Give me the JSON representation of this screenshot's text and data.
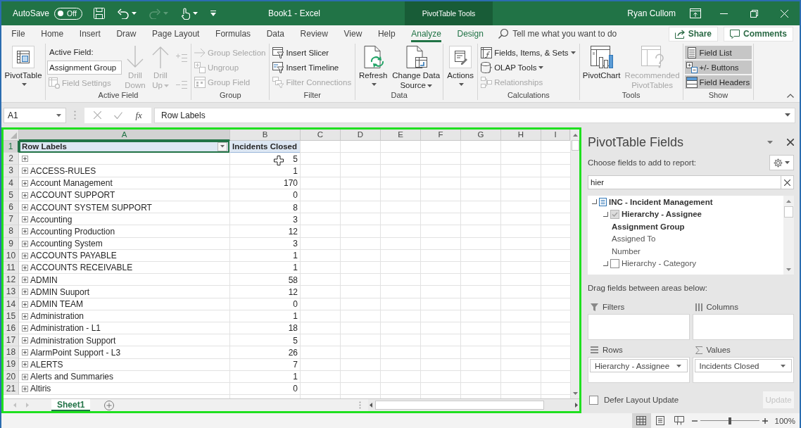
{
  "title_bar": {
    "autosave_label": "AutoSave",
    "autosave_toggle": {
      "label": "Off",
      "on": false
    },
    "document_title": "Book1 - Excel",
    "context_label": "PivotTable Tools",
    "user_name": "Ryan Cullom"
  },
  "ribbon_tabs": [
    {
      "label": "File",
      "kind": "standard",
      "selected": false
    },
    {
      "label": "Home",
      "kind": "standard",
      "selected": false
    },
    {
      "label": "Insert",
      "kind": "standard",
      "selected": false
    },
    {
      "label": "Draw",
      "kind": "standard",
      "selected": false
    },
    {
      "label": "Page Layout",
      "kind": "standard",
      "selected": false
    },
    {
      "label": "Formulas",
      "kind": "standard",
      "selected": false
    },
    {
      "label": "Data",
      "kind": "standard",
      "selected": false
    },
    {
      "label": "Review",
      "kind": "standard",
      "selected": false
    },
    {
      "label": "View",
      "kind": "standard",
      "selected": false
    },
    {
      "label": "Help",
      "kind": "standard",
      "selected": false
    },
    {
      "label": "Analyze",
      "kind": "contextual",
      "selected": true
    },
    {
      "label": "Design",
      "kind": "contextual",
      "selected": false
    }
  ],
  "tell_me": {
    "placeholder": "Tell me what you want to do"
  },
  "share_button": {
    "label": "Share"
  },
  "comments_button": {
    "label": "Comments"
  },
  "ribbon_groups": [
    {
      "controls": [
        {
          "kind": "large",
          "label": "PivotTable",
          "disabled": false,
          "dropdown": true
        }
      ]
    },
    {
      "label": "Active Field",
      "controls": [
        {
          "kind": "field",
          "label": "Active Field:",
          "value": "Assignment Group",
          "items": [
            {
              "label": "Field Settings",
              "disabled": true,
              "dropdown": false
            }
          ]
        },
        {
          "kind": "large",
          "label": "Drill Down",
          "disabled": true,
          "dropdown": false
        },
        {
          "kind": "large",
          "label": "Drill Up",
          "disabled": true,
          "dropdown": true
        },
        {
          "kind": "icons",
          "items": [
            {
              "disabled": true
            },
            {
              "disabled": true
            }
          ]
        }
      ]
    },
    {
      "label": "Group",
      "controls": [
        {
          "kind": "stack",
          "items": [
            {
              "label": "Group Selection",
              "disabled": true,
              "dropdown": false
            },
            {
              "label": "Ungroup",
              "disabled": true,
              "dropdown": false
            },
            {
              "label": "Group Field",
              "disabled": true,
              "dropdown": false
            }
          ]
        }
      ]
    },
    {
      "label": "Filter",
      "controls": [
        {
          "kind": "stack",
          "items": [
            {
              "label": "Insert Slicer",
              "disabled": false,
              "dropdown": false
            },
            {
              "label": "Insert Timeline",
              "disabled": false,
              "dropdown": false
            },
            {
              "label": "Filter Connections",
              "disabled": true,
              "dropdown": false
            }
          ]
        }
      ]
    },
    {
      "label": "Data",
      "controls": [
        {
          "kind": "large",
          "label": "Refresh",
          "disabled": false,
          "dropdown": true
        },
        {
          "kind": "large",
          "label": "Change Data Source",
          "disabled": false,
          "dropdown": true
        }
      ]
    },
    {
      "controls": [
        {
          "kind": "large",
          "label": "Actions",
          "disabled": false,
          "dropdown": true
        }
      ]
    },
    {
      "label": "Calculations",
      "controls": [
        {
          "kind": "stack",
          "items": [
            {
              "label": "Fields, Items, & Sets",
              "disabled": false,
              "dropdown": true
            },
            {
              "label": "OLAP Tools",
              "disabled": false,
              "dropdown": true
            },
            {
              "label": "Relationships",
              "disabled": true,
              "dropdown": false
            }
          ]
        }
      ]
    },
    {
      "label": "Tools",
      "controls": [
        {
          "kind": "large",
          "label": "PivotChart",
          "disabled": false,
          "dropdown": false
        },
        {
          "kind": "large",
          "label": "Recommended PivotTables",
          "disabled": true,
          "dropdown": false
        }
      ]
    },
    {
      "label": "Show",
      "controls": [
        {
          "kind": "stack",
          "items": [
            {
              "label": "Field List",
              "disabled": false,
              "dropdown": false,
              "on": true
            },
            {
              "label": "+/- Buttons",
              "disabled": false,
              "dropdown": false,
              "on": true
            },
            {
              "label": "Field Headers",
              "disabled": false,
              "dropdown": false,
              "on": true
            }
          ]
        }
      ]
    }
  ],
  "formula_bar": {
    "name_box": "A1",
    "insert_function": "fx",
    "formula": "Row Labels"
  },
  "sheet": {
    "columns": [
      {
        "label": "A",
        "selected": true
      },
      {
        "label": "B",
        "selected": false
      },
      {
        "label": "C",
        "selected": false
      },
      {
        "label": "D",
        "selected": false
      },
      {
        "label": "E",
        "selected": false
      },
      {
        "label": "F",
        "selected": false
      },
      {
        "label": "G",
        "selected": false
      },
      {
        "label": "H",
        "selected": false
      },
      {
        "label": "I",
        "selected": false
      }
    ],
    "header_row": {
      "number": "1",
      "selected": true,
      "row_label_header": "Row Labels",
      "value_header": "Incidents Closed"
    },
    "rows": [
      {
        "number": "2",
        "selected": false,
        "expanded": false,
        "value": "5"
      },
      {
        "number": "3",
        "selected": false,
        "expanded": false,
        "label": "ACCESS-RULES",
        "value": "1"
      },
      {
        "number": "4",
        "selected": false,
        "expanded": false,
        "label": "Account Management",
        "value": "170"
      },
      {
        "number": "5",
        "selected": false,
        "expanded": false,
        "label": "ACCOUNT SUPPORT",
        "value": "0"
      },
      {
        "number": "6",
        "selected": false,
        "expanded": false,
        "label": "ACCOUNT SYSTEM SUPPORT",
        "value": "8"
      },
      {
        "number": "7",
        "selected": false,
        "expanded": false,
        "label": "Accounting",
        "value": "3"
      },
      {
        "number": "8",
        "selected": false,
        "expanded": false,
        "label": "Accounting Production",
        "value": "12"
      },
      {
        "number": "9",
        "selected": false,
        "expanded": false,
        "label": "Accounting System",
        "value": "3"
      },
      {
        "number": "10",
        "selected": false,
        "expanded": false,
        "label": "ACCOUNTS PAYABLE",
        "value": "1"
      },
      {
        "number": "11",
        "selected": false,
        "expanded": false,
        "label": "ACCOUNTS RECEIVABLE",
        "value": "1"
      },
      {
        "number": "12",
        "selected": false,
        "expanded": false,
        "label": "ADMIN",
        "value": "58"
      },
      {
        "number": "13",
        "selected": false,
        "expanded": false,
        "label": "ADMIN Suuport",
        "value": "12"
      },
      {
        "number": "14",
        "selected": false,
        "expanded": false,
        "label": "ADMIN TEAM",
        "value": "0"
      },
      {
        "number": "15",
        "selected": false,
        "expanded": false,
        "label": "Administration",
        "value": "1"
      },
      {
        "number": "16",
        "selected": false,
        "expanded": false,
        "label": "Administration - L1",
        "value": "18"
      },
      {
        "number": "17",
        "selected": false,
        "expanded": false,
        "label": "Administration Support",
        "value": "5"
      },
      {
        "number": "18",
        "selected": false,
        "expanded": false,
        "label": "AlarmPoint Support - L3",
        "value": "26"
      },
      {
        "number": "19",
        "selected": false,
        "expanded": false,
        "label": "ALERTS",
        "value": "7"
      },
      {
        "number": "20",
        "selected": false,
        "expanded": false,
        "label": "Alerts and Summaries",
        "value": "1"
      },
      {
        "number": "21",
        "selected": false,
        "expanded": false,
        "label": "Altiris",
        "value": "0"
      }
    ],
    "tabs": [
      {
        "label": "Sheet1",
        "selected": true
      }
    ]
  },
  "pivot_fields": {
    "title": "PivotTable Fields",
    "instruction": "Choose fields to add to report:",
    "search": {
      "value": "hier"
    },
    "field_tree": [
      {
        "kind": "table",
        "label": "INC - Incident Management",
        "expanded": true,
        "children": [
          {
            "kind": "hierarchy",
            "label": "Hierarchy - Assignee",
            "checked": true,
            "expanded": true,
            "children": [
              {
                "kind": "level",
                "label": "Assignment Group",
                "in_use": true
              },
              {
                "kind": "level",
                "label": "Assigned To",
                "in_use": false
              },
              {
                "kind": "level",
                "label": "Number",
                "in_use": false
              }
            ]
          },
          {
            "kind": "hierarchy",
            "label": "Hierarchy - Category",
            "checked": false,
            "expanded": true
          }
        ]
      }
    ],
    "areas_hint": "Drag fields between areas below:",
    "areas": [
      {
        "kind": "filters",
        "label": "Filters"
      },
      {
        "kind": "columns",
        "label": "Columns"
      },
      {
        "kind": "rows",
        "label": "Rows",
        "fields": [
          "Hierarchy - Assignee"
        ]
      },
      {
        "kind": "values",
        "label": "Values",
        "fields": [
          "Incidents Closed"
        ]
      }
    ],
    "defer_update": {
      "label": "Defer Layout Update",
      "checked": false
    },
    "update_button": {
      "label": "Update",
      "disabled": true
    }
  },
  "status_bar": {
    "views": [
      {
        "selected": true
      },
      {
        "selected": false
      },
      {
        "selected": false
      }
    ],
    "zoom": {
      "level": 0.5,
      "label": "100%"
    }
  }
}
